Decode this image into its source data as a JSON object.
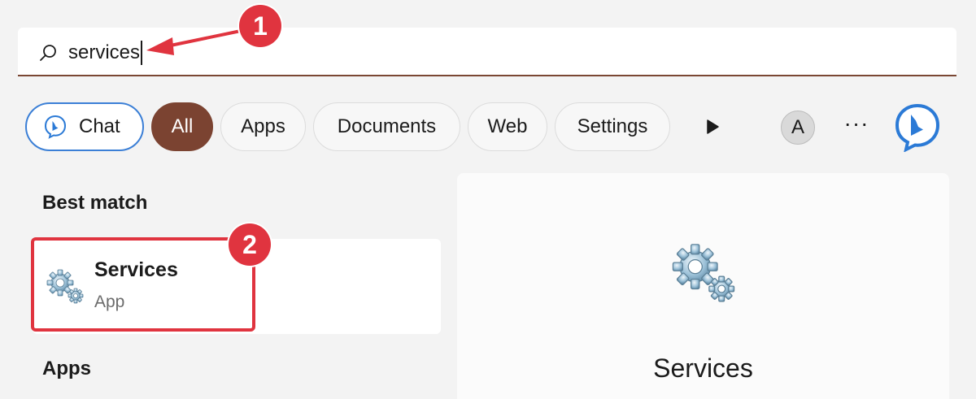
{
  "search": {
    "query": "services"
  },
  "filters": {
    "chat": "Chat",
    "all": "All",
    "apps": "Apps",
    "documents": "Documents",
    "web": "Web",
    "settings": "Settings"
  },
  "account": {
    "initial": "A"
  },
  "toolbar": {
    "more_label": "···"
  },
  "results": {
    "best_match_heading": "Best match",
    "best_match": {
      "name": "Services",
      "type": "App"
    },
    "apps_heading": "Apps"
  },
  "preview": {
    "title": "Services"
  },
  "annotations": {
    "step1": "1",
    "step2": "2"
  },
  "colors": {
    "accent": "#7b4331",
    "chat_border": "#3b7fd6",
    "annotation_red": "#e0343f"
  },
  "icons": {
    "search": "search-icon",
    "bing": "bing-icon",
    "more_tabs": "play-arrow-icon",
    "services": "gears-icon"
  }
}
